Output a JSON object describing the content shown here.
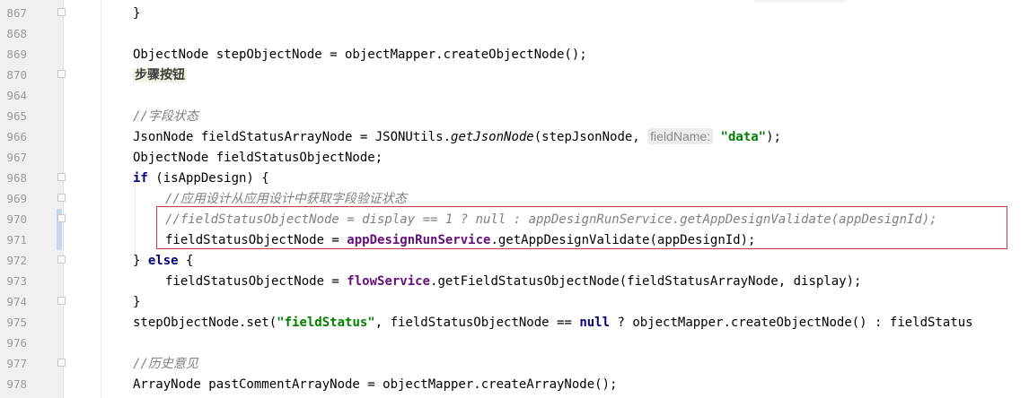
{
  "lines": {
    "l867": {
      "num": "867",
      "code": "}"
    },
    "l868": {
      "num": "868"
    },
    "l869": {
      "num": "869",
      "code": "ObjectNode stepObjectNode = objectMapper.createObjectNode();"
    },
    "l870": {
      "num": "870",
      "label": "步骤按钮"
    },
    "l964": {
      "num": "964"
    },
    "l965": {
      "num": "965",
      "comment": "//字段状态"
    },
    "l966": {
      "num": "966",
      "a": "JsonNode fieldStatusArrayNode = JSONUtils.",
      "method": "getJsonNode",
      "b": "(stepJsonNode, ",
      "hint": "fieldName:",
      "str": "\"data\"",
      "c": ");"
    },
    "l967": {
      "num": "967",
      "code": "ObjectNode fieldStatusObjectNode;"
    },
    "l968": {
      "num": "968",
      "kw": "if",
      "code": " (isAppDesign) {"
    },
    "l969": {
      "num": "969",
      "comment": "//应用设计从应用设计中获取字段验证状态"
    },
    "l970": {
      "num": "970",
      "comment": "//fieldStatusObjectNode = display == 1 ? null : appDesignRunService.getAppDesignValidate(appDesignId);"
    },
    "l971": {
      "num": "971",
      "a": "fieldStatusObjectNode = ",
      "field": "appDesignRunService",
      "b": ".getAppDesignValidate(appDesignId);"
    },
    "l972": {
      "num": "972",
      "a": "} ",
      "kw": "else",
      "b": " {"
    },
    "l973": {
      "num": "973",
      "a": "fieldStatusObjectNode = ",
      "field": "flowService",
      "b": ".getFieldStatusObjectNode(fieldStatusArrayNode, display);"
    },
    "l974": {
      "num": "974",
      "code": "}"
    },
    "l975": {
      "num": "975",
      "a": "stepObjectNode.set(",
      "str": "\"fieldStatus\"",
      "b": ", fieldStatusObjectNode == ",
      "kw": "null",
      "c": " ? objectMapper.createObjectNode() : fieldStatus"
    },
    "l976": {
      "num": "976"
    },
    "l977": {
      "num": "977",
      "comment": "//历史意见"
    },
    "l978": {
      "num": "978",
      "code": "ArrayNode pastCommentArrayNode = objectMapper.createArrayNode();"
    }
  },
  "colors": {
    "keyword": "#000080",
    "string": "#008000",
    "field": "#660e7a",
    "comment": "#808080",
    "highlight_border": "#c53b3b"
  }
}
